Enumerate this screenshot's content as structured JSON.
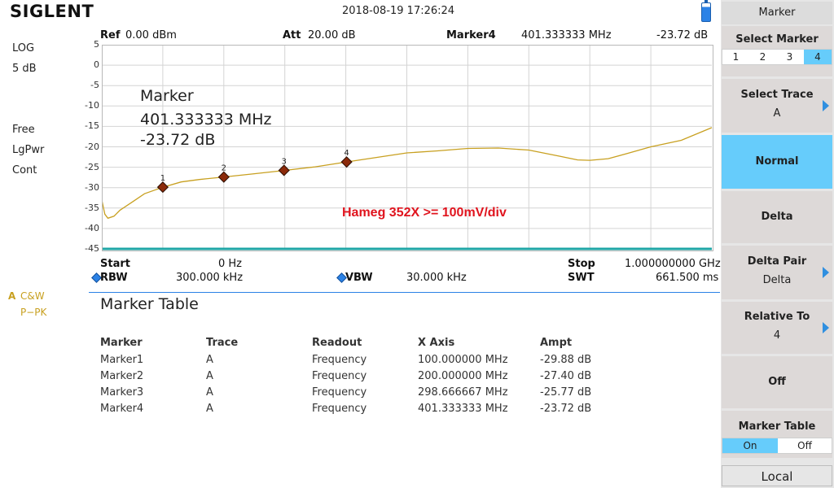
{
  "header": {
    "brand": "SIGLENT",
    "datetime": "2018-08-19   17:26:24"
  },
  "left_status": {
    "scale": "LOG",
    "div": "5 dB",
    "trig": "Free",
    "mode": "LgPwr",
    "sweep": "Cont",
    "trace_letter": "A",
    "trace_mode1": "C&W",
    "trace_mode2": "P−PK"
  },
  "top_bar": {
    "ref_label": "Ref",
    "ref_value": "0.00 dBm",
    "att_label": "Att",
    "att_value": "20.00 dB",
    "marker_label": "Marker4",
    "marker_freq": "401.333333 MHz",
    "marker_ampl": "-23.72 dB"
  },
  "plot": {
    "y_ticks": [
      "5",
      "0",
      "-5",
      "-10",
      "-15",
      "-20",
      "-25",
      "-30",
      "-35",
      "-40",
      "-45"
    ],
    "marker_box": {
      "title": "Marker",
      "freq": "401.333333 MHz",
      "ampl": "-23.72 dB"
    },
    "annotation": "Hameg 352X  >= 100mV/div",
    "annotation_color": "#e0141e",
    "trace_color": "#c8a020"
  },
  "chart_data": {
    "type": "line",
    "xlabel": "",
    "ylabel": "",
    "x_unit": "GHz",
    "xlim": [
      0,
      1.0
    ],
    "ylim": [
      -45,
      5
    ],
    "series": [
      {
        "x": [
          0.0,
          0.005,
          0.01,
          0.02,
          0.03,
          0.05,
          0.07,
          0.1,
          0.13,
          0.16,
          0.2,
          0.25,
          0.2987,
          0.35,
          0.4013,
          0.45,
          0.5,
          0.55,
          0.6,
          0.65,
          0.7,
          0.75,
          0.78,
          0.8,
          0.83,
          0.86,
          0.9,
          0.95,
          1.0
        ],
        "values": [
          -33,
          -36.5,
          -37.5,
          -37,
          -35.5,
          -33.5,
          -31.5,
          -29.9,
          -28.6,
          -28.0,
          -27.4,
          -26.6,
          -25.8,
          -24.9,
          -23.7,
          -22.6,
          -21.5,
          -21.0,
          -20.4,
          -20.3,
          -20.8,
          -22.3,
          -23.2,
          -23.3,
          -22.9,
          -21.7,
          -20.0,
          -18.4,
          -15.3
        ]
      }
    ],
    "markers": [
      {
        "label": "1",
        "x": 0.1,
        "y": -29.88
      },
      {
        "label": "2",
        "x": 0.2,
        "y": -27.4
      },
      {
        "label": "3",
        "x": 0.298666667,
        "y": -25.77
      },
      {
        "label": "4",
        "x": 0.401333333,
        "y": -23.72
      }
    ]
  },
  "bottom_bar": {
    "start_label": "Start",
    "start_value": "0 Hz",
    "stop_label": "Stop",
    "stop_value": "1.000000000 GHz",
    "rbw_label": "RBW",
    "rbw_value": "300.000 kHz",
    "vbw_label": "VBW",
    "vbw_value": "30.000 kHz",
    "swt_label": "SWT",
    "swt_value": "661.500 ms"
  },
  "marker_table": {
    "title": "Marker Table",
    "headers": [
      "Marker",
      "Trace",
      "Readout",
      "X Axis",
      "Ampt"
    ],
    "rows": [
      [
        "Marker1",
        "A",
        "Frequency",
        "100.000000 MHz",
        "-29.88 dB"
      ],
      [
        "Marker2",
        "A",
        "Frequency",
        "200.000000 MHz",
        "-27.40 dB"
      ],
      [
        "Marker3",
        "A",
        "Frequency",
        "298.666667 MHz",
        "-25.77 dB"
      ],
      [
        "Marker4",
        "A",
        "Frequency",
        "401.333333 MHz",
        "-23.72 dB"
      ]
    ]
  },
  "softkeys": {
    "menu_title": "Marker",
    "select_marker": {
      "label": "Select Marker",
      "options": [
        "1",
        "2",
        "3",
        "4"
      ],
      "selected": "4"
    },
    "select_trace": {
      "label": "Select Trace",
      "value": "A"
    },
    "normal": "Normal",
    "delta": "Delta",
    "delta_pair": {
      "label": "Delta Pair",
      "value": "Delta"
    },
    "relative_to": {
      "label": "Relative To",
      "value": "4"
    },
    "off": "Off",
    "marker_table": {
      "label": "Marker Table",
      "on": "On",
      "off": "Off"
    },
    "local": "Local"
  },
  "colors": {
    "accent": "#66ccfb",
    "trace": "#c8a020",
    "marker": "#8b2a0a",
    "annotation": "#e0141e"
  }
}
